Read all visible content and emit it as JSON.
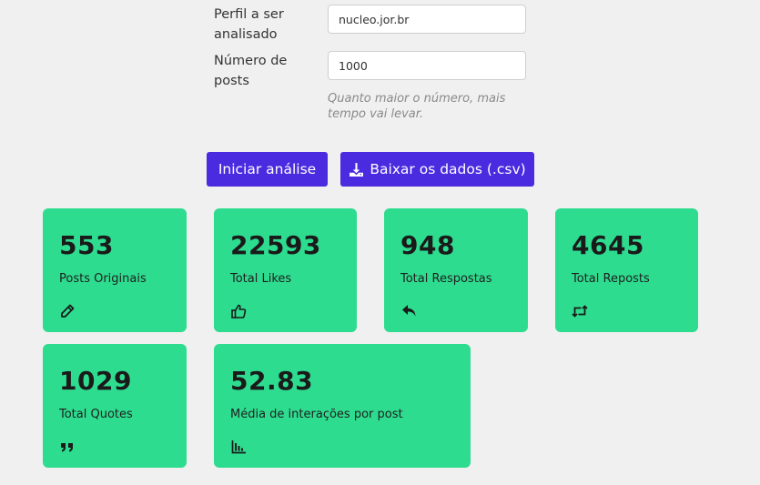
{
  "form": {
    "profile_label": "Perfil a ser analisado",
    "profile_value": "nucleo.jor.br",
    "posts_label": "Número de posts",
    "posts_value": "1000",
    "hint": "Quanto maior o número, mais tempo vai levar."
  },
  "actions": {
    "start_label": "Iniciar análise",
    "download_label": "Baixar os dados (.csv)",
    "accent_color": "#4a2be0"
  },
  "stats": {
    "card_color": "#2edc8f",
    "items": [
      {
        "value": "553",
        "label": "Posts Originais",
        "icon": "pencil-icon"
      },
      {
        "value": "22593",
        "label": "Total Likes",
        "icon": "thumbs-up-icon"
      },
      {
        "value": "948",
        "label": "Total Respostas",
        "icon": "reply-icon"
      },
      {
        "value": "4645",
        "label": "Total Reposts",
        "icon": "retweet-icon"
      },
      {
        "value": "1029",
        "label": "Total Quotes",
        "icon": "quote-icon"
      },
      {
        "value": "52.83",
        "label": "Média de interações por post",
        "icon": "chart-icon"
      }
    ]
  }
}
